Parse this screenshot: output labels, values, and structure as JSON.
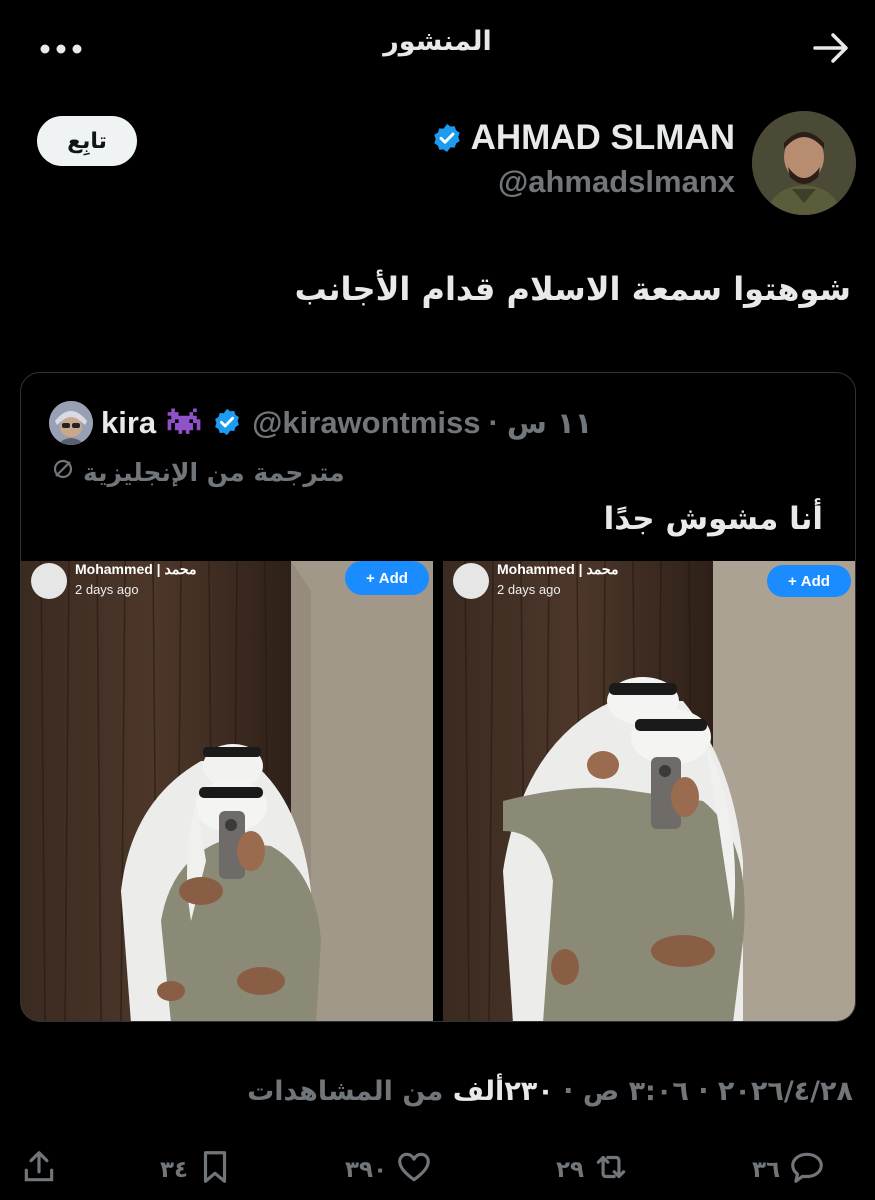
{
  "header": {
    "title": "المنشور"
  },
  "author": {
    "name": "AHMAD SLMAN",
    "handle": "@ahmadslmanx",
    "follow_label": "تابِع"
  },
  "post": {
    "text": "شوهتوا سمعة الاسلام قدام الأجانب"
  },
  "quote": {
    "name": "kira",
    "handle": "@kirawontmiss",
    "separator": "·",
    "time": "١١ س",
    "translated_label": "مترجمة من الإنجليزية",
    "text": "أنا مشوش جدًا",
    "media": [
      {
        "user": "Mohammed | محمد",
        "time": "2 days ago",
        "add_label": "Add"
      },
      {
        "user": "Mohammed | محمد",
        "time": "2 days ago",
        "add_label": "Add"
      }
    ]
  },
  "meta": {
    "date": "٢٠٢٦/٤/٢٨",
    "sep": "·",
    "time": "٣:٠٦ ص",
    "views_count": "٢٣٠ألف",
    "views_label": "من المشاهدات"
  },
  "actions": {
    "replies": "٣٦",
    "reposts": "٢٩",
    "likes": "٣٩٠",
    "bookmarks": "٣٤"
  },
  "colors": {
    "verified": "#1d9bf0",
    "accent": "#1a8cff",
    "muted": "#71767b"
  }
}
